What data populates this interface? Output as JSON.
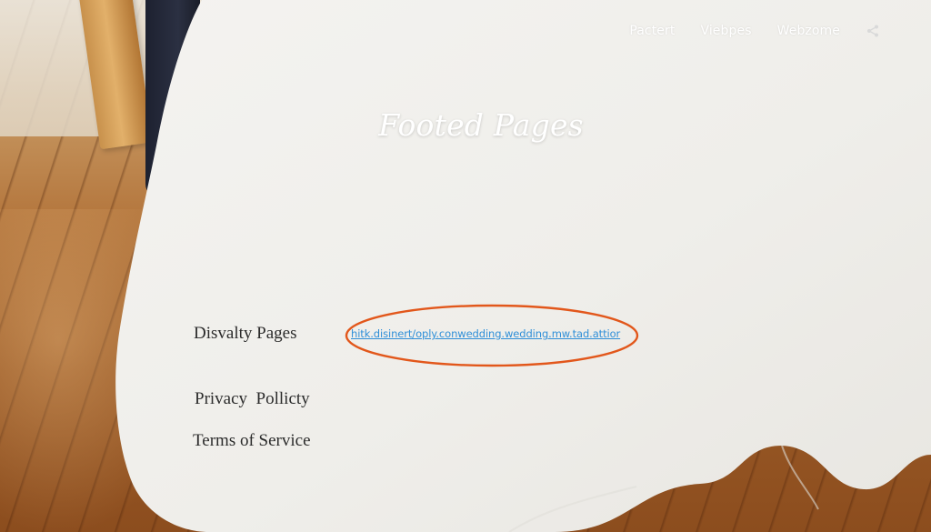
{
  "nav": {
    "items": [
      "Pactert",
      "Viebpes",
      "Webzome"
    ],
    "share_icon": "share-icon"
  },
  "title": "Footed Pages",
  "footer": {
    "links": [
      {
        "label": "Disvalty Pages"
      },
      {
        "label": "Privacy  Pollicty"
      },
      {
        "label": "Terms of Service"
      }
    ],
    "url": "hitk.disinert/oply.conwedding.wedding.mw.tad.attior"
  },
  "colors": {
    "link": "#2f8fd8",
    "highlight": "#e2571b",
    "cloth": "#f0efec",
    "text": "#2b2b2b"
  }
}
